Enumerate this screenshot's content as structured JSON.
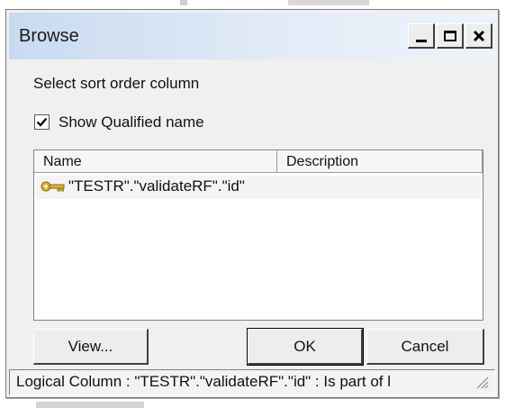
{
  "window": {
    "title": "Browse"
  },
  "labels": {
    "select_sort": "Select sort order column",
    "show_qualified": "Show Qualified name",
    "show_qualified_checked": true
  },
  "list": {
    "columns": [
      "Name",
      "Description"
    ],
    "rows": [
      {
        "name": "\"TESTR\".\"validateRF\".\"id\"",
        "description": "",
        "icon": "key-icon"
      }
    ]
  },
  "buttons": {
    "view": "View...",
    "ok": "OK",
    "cancel": "Cancel"
  },
  "status": {
    "text": "Logical Column : \"TESTR\".\"validateRF\".\"id\" : Is part of l"
  },
  "colors": {
    "titlebar_start": "#c9daf0",
    "dialog_bg": "#f0f0f0",
    "key_icon": "#d7b53a"
  }
}
